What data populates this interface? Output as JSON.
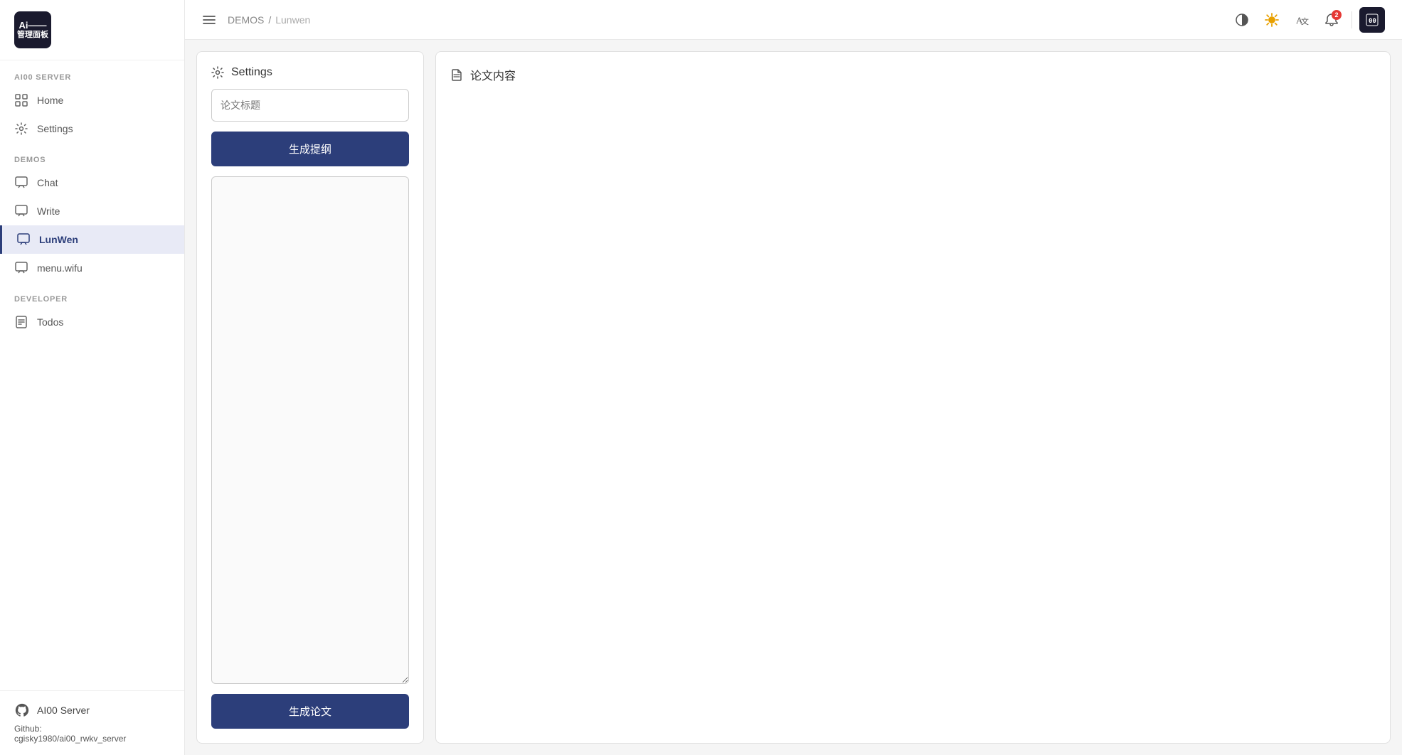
{
  "app": {
    "logo_line1": "Ai——",
    "logo_line2": "管理面板"
  },
  "sidebar": {
    "sections": [
      {
        "label": "AI00 SERVER",
        "items": [
          {
            "id": "home",
            "label": "Home",
            "icon": "grid-icon",
            "active": false
          },
          {
            "id": "settings",
            "label": "Settings",
            "icon": "gear-icon",
            "active": false
          }
        ]
      },
      {
        "label": "DEMOS",
        "items": [
          {
            "id": "chat",
            "label": "Chat",
            "icon": "chat-icon",
            "active": false
          },
          {
            "id": "write",
            "label": "Write",
            "icon": "write-icon",
            "active": false
          },
          {
            "id": "lunwen",
            "label": "LunWen",
            "icon": "lunwen-icon",
            "active": true
          },
          {
            "id": "menu-wifu",
            "label": "menu.wifu",
            "icon": "menu-icon",
            "active": false
          }
        ]
      },
      {
        "label": "DEVELOPER",
        "items": [
          {
            "id": "todos",
            "label": "Todos",
            "icon": "todos-icon",
            "active": false
          }
        ]
      }
    ],
    "footer": {
      "server_label": "AI00 Server",
      "github_label": "Github:",
      "github_url": "cgisky1980/ai00_rwkv_server"
    }
  },
  "topbar": {
    "breadcrumb_root": "DEMOS",
    "breadcrumb_separator": "/",
    "breadcrumb_current": "Lunwen",
    "notification_count": "2"
  },
  "left_panel": {
    "header_icon": "settings-icon",
    "header_title": "Settings",
    "title_placeholder": "论文标题",
    "generate_outline_btn": "生成提纲",
    "outline_placeholder": "",
    "generate_essay_btn": "生成论文"
  },
  "right_panel": {
    "header_icon": "document-icon",
    "header_title": "论文内容"
  }
}
